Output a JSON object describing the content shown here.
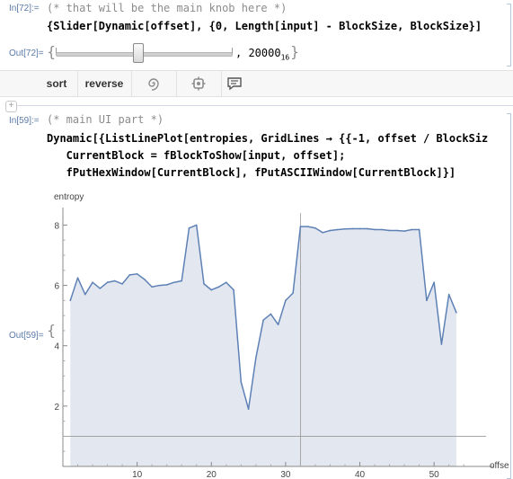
{
  "cell72": {
    "in_label": "In[72]:=",
    "comment_line": "(* that will be the main knob here *)",
    "code_line": "{Slider[Dynamic[offset], {0, Length[input] - BlockSize, BlockSize}]",
    "out_label": "Out[72]=",
    "slider_fraction": 0.47,
    "slider_value": "20000",
    "slider_value_base": "16"
  },
  "toolbar": {
    "sort_label": "sort",
    "reverse_label": "reverse"
  },
  "cell59": {
    "in_label": "In[59]:=",
    "comment_line": "(* main UI part *)",
    "code_lines": [
      "Dynamic[{ListLinePlot[entropies, GridLines → {{-1, offset / BlockSiz",
      "   CurrentBlock = fBlockToShow[input, offset];",
      "   fPutHexWindow[CurrentBlock], fPutASCIIWindow[CurrentBlock]}]"
    ],
    "out_label": "Out[59]="
  },
  "chart_data": {
    "type": "area",
    "ylabel": "entropy",
    "xlabel": "offse",
    "x_ticks": [
      "10",
      "20",
      "30",
      "40",
      "50"
    ],
    "y_ticks": [
      "2",
      "4",
      "6",
      "8"
    ],
    "xlim": [
      0,
      57
    ],
    "ylim": [
      0,
      8.4
    ],
    "gridlines": {
      "x": 32,
      "y": 1
    },
    "colors": {
      "line": "#5e81b5",
      "fill": "#e3e7f0",
      "grid": "#9a9a9a"
    },
    "x": [
      1,
      2,
      3,
      4,
      5,
      6,
      7,
      8,
      9,
      10,
      11,
      12,
      13,
      14,
      15,
      16,
      17,
      18,
      19,
      20,
      21,
      22,
      23,
      24,
      25,
      26,
      27,
      28,
      29,
      30,
      31,
      32,
      33,
      34,
      35,
      36,
      37,
      38,
      39,
      40,
      41,
      42,
      43,
      44,
      45,
      46,
      47,
      48,
      49,
      50,
      51,
      52,
      53
    ],
    "y": [
      5.5,
      6.25,
      5.7,
      6.1,
      5.9,
      6.1,
      6.15,
      6.05,
      6.35,
      6.38,
      6.2,
      5.95,
      6.0,
      6.02,
      6.1,
      6.15,
      7.9,
      8.0,
      6.05,
      5.85,
      5.95,
      6.1,
      5.85,
      2.8,
      1.9,
      3.6,
      4.85,
      5.05,
      4.7,
      5.5,
      5.75,
      7.95,
      7.95,
      7.9,
      7.75,
      7.82,
      7.85,
      7.87,
      7.88,
      7.88,
      7.88,
      7.85,
      7.85,
      7.82,
      7.82,
      7.8,
      7.85,
      7.85,
      5.5,
      6.1,
      4.05,
      5.7,
      5.1
    ]
  }
}
